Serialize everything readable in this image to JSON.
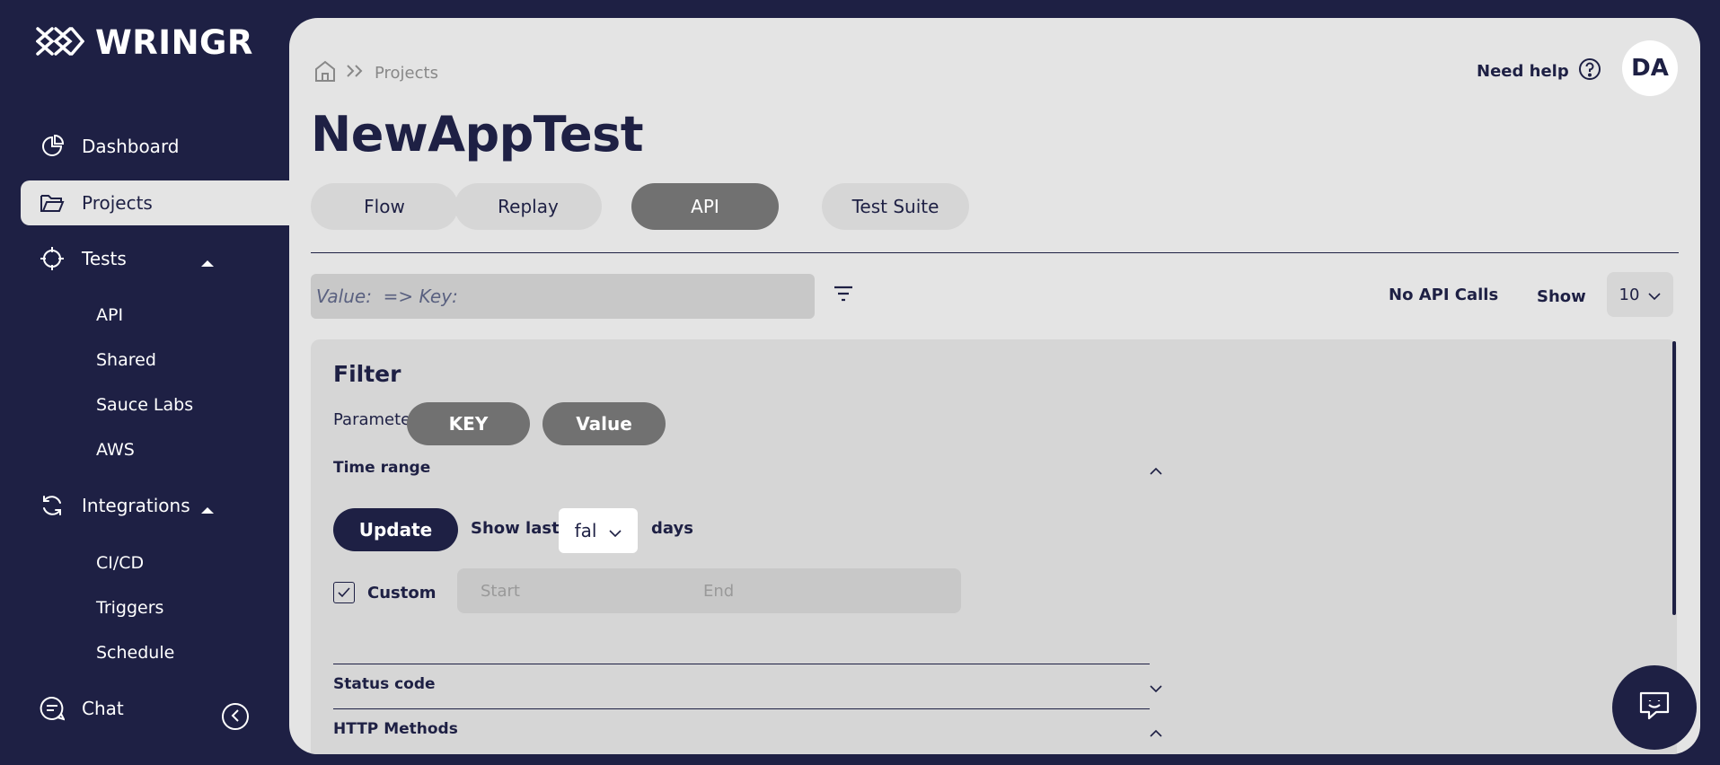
{
  "app": {
    "name": "WRINGR"
  },
  "sidebar": {
    "items": [
      {
        "label": "Dashboard",
        "icon": "pie-chart-icon"
      },
      {
        "label": "Projects",
        "icon": "folder-icon",
        "active": true
      },
      {
        "label": "Tests",
        "icon": "crosshair-icon",
        "expanded": true
      },
      {
        "label": "Integrations",
        "icon": "refresh-icon",
        "expanded": true
      },
      {
        "label": "Chat",
        "icon": "chat-icon"
      }
    ],
    "tests_children": [
      "API",
      "Shared",
      "Sauce Labs",
      "AWS"
    ],
    "integrations_children": [
      "CI/CD",
      "Triggers",
      "Schedule"
    ]
  },
  "header": {
    "breadcrumb": "Projects",
    "help_label": "Need help",
    "avatar_initials": "DA"
  },
  "page": {
    "title": "NewAppTest",
    "tabs": [
      {
        "label": "Flow"
      },
      {
        "label": "Replay"
      },
      {
        "label": "API",
        "active": true
      },
      {
        "label": "Test Suite"
      }
    ]
  },
  "toolbar": {
    "search_placeholder": "Value:  => Key:",
    "status": "No API Calls",
    "show_label": "Show",
    "show_value": "10"
  },
  "filter": {
    "title": "Filter",
    "parameter_label": "Parameter",
    "key_label": "KEY",
    "value_label": "Value",
    "time_range_label": "Time range",
    "update_label": "Update",
    "show_last_label": "Show last",
    "days_value": "fal",
    "days_label": "days",
    "custom_label": "Custom",
    "custom_checked": true,
    "start_placeholder": "Start",
    "end_placeholder": "End",
    "status_code_label": "Status code",
    "http_methods_label": "HTTP Methods"
  },
  "colors": {
    "navy": "#1e2044",
    "panel": "#e4e4e4",
    "active_tab": "#717171"
  }
}
